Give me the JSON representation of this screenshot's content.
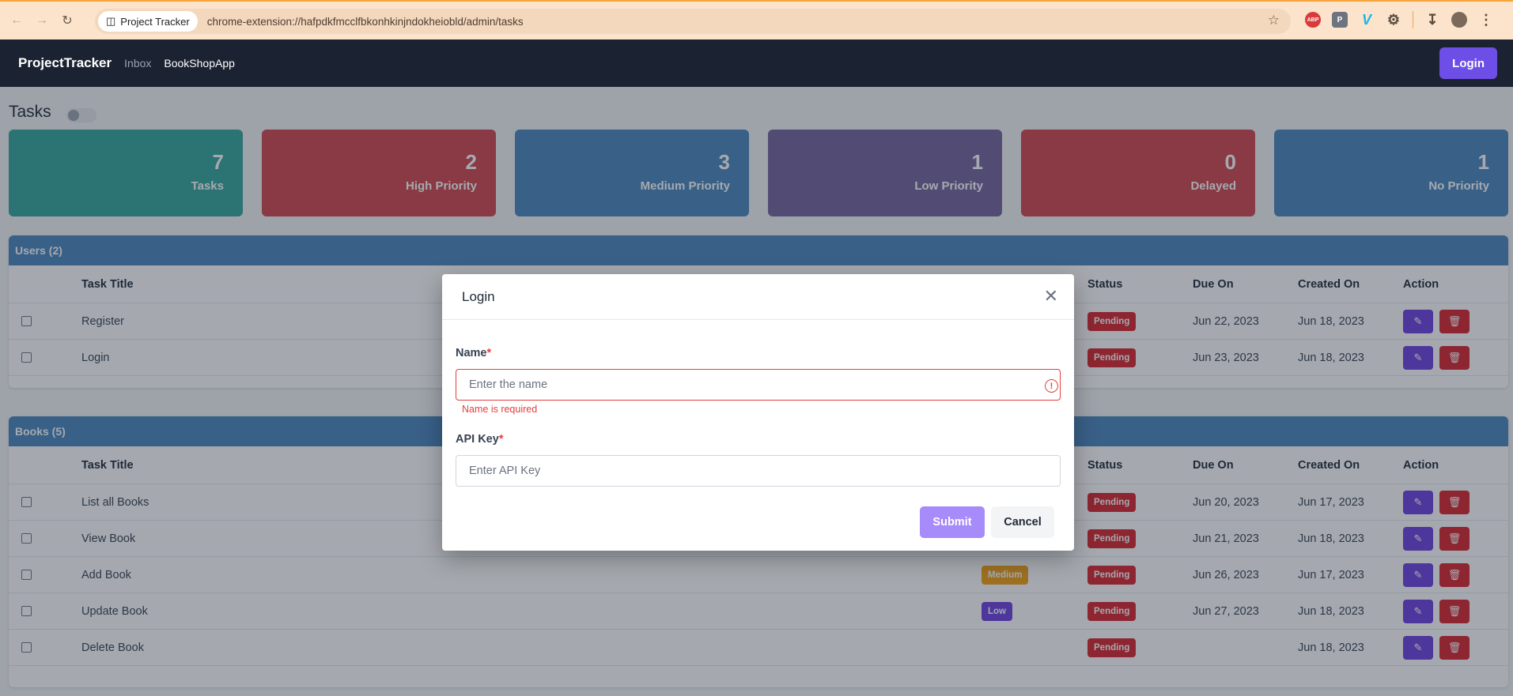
{
  "browser": {
    "tab_label": "Project Tracker",
    "url": "chrome-extension://hafpdkfmcclfbkonhkinjndokheiobld/admin/tasks",
    "ext_abp": "ABP",
    "ext_p": "P",
    "ext_v": "V"
  },
  "navbar": {
    "brand": "ProjectTracker",
    "links": [
      "Inbox",
      "BookShopApp"
    ],
    "login_label": "Login"
  },
  "page": {
    "title": "Tasks"
  },
  "stats": [
    {
      "value": "7",
      "label": "Tasks",
      "color": "#36a59b"
    },
    {
      "value": "2",
      "label": "High Priority",
      "color": "#d1474d"
    },
    {
      "value": "3",
      "label": "Medium Priority",
      "color": "#4b86bd"
    },
    {
      "value": "1",
      "label": "Low Priority",
      "color": "#76659e"
    },
    {
      "value": "0",
      "label": "Delayed",
      "color": "#d1474d"
    },
    {
      "value": "1",
      "label": "No Priority",
      "color": "#4b86bd"
    }
  ],
  "users_panel": {
    "title": "Users (2)",
    "headers": {
      "task_title": "Task Title",
      "status": "Status",
      "due_on": "Due On",
      "created_on": "Created On",
      "action": "Action"
    },
    "rows": [
      {
        "title": "Register",
        "priority": "",
        "status": "Pending",
        "due": "Jun 22, 2023",
        "created": "Jun 18, 2023"
      },
      {
        "title": "Login",
        "priority": "",
        "status": "Pending",
        "due": "Jun 23, 2023",
        "created": "Jun 18, 2023"
      }
    ]
  },
  "books_panel": {
    "title": "Books (5)",
    "headers": {
      "task_title": "Task Title",
      "status": "Status",
      "due_on": "Due On",
      "created_on": "Created On",
      "action": "Action"
    },
    "rows": [
      {
        "title": "List all Books",
        "priority": "",
        "status": "Pending",
        "due": "Jun 20, 2023",
        "created": "Jun 17, 2023"
      },
      {
        "title": "View Book",
        "priority": "",
        "status": "Pending",
        "due": "Jun 21, 2023",
        "created": "Jun 18, 2023"
      },
      {
        "title": "Add Book",
        "priority": "Medium",
        "status": "Pending",
        "due": "Jun 26, 2023",
        "created": "Jun 17, 2023"
      },
      {
        "title": "Update Book",
        "priority": "Low",
        "status": "Pending",
        "due": "Jun 27, 2023",
        "created": "Jun 18, 2023"
      },
      {
        "title": "Delete Book",
        "priority": "",
        "status": "Pending",
        "due": "",
        "created": "Jun 18, 2023"
      }
    ]
  },
  "modal": {
    "title": "Login",
    "name_label": "Name",
    "name_placeholder": "Enter the name",
    "name_value": "",
    "name_error": "Name is required",
    "api_label": "API Key",
    "api_placeholder": "Enter API Key",
    "api_value": "",
    "required_mark": "*",
    "submit_label": "Submit",
    "cancel_label": "Cancel"
  }
}
